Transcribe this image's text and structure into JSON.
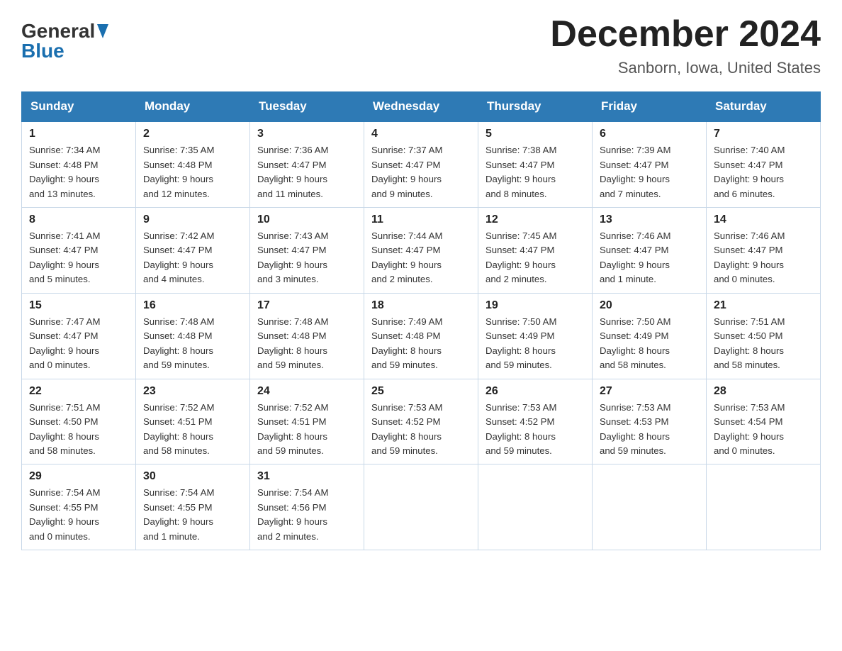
{
  "header": {
    "logo_general": "General",
    "logo_blue": "Blue",
    "month_title": "December 2024",
    "location": "Sanborn, Iowa, United States"
  },
  "days_of_week": [
    "Sunday",
    "Monday",
    "Tuesday",
    "Wednesday",
    "Thursday",
    "Friday",
    "Saturday"
  ],
  "weeks": [
    [
      {
        "day": "1",
        "sunrise": "7:34 AM",
        "sunset": "4:48 PM",
        "daylight": "9 hours and 13 minutes."
      },
      {
        "day": "2",
        "sunrise": "7:35 AM",
        "sunset": "4:48 PM",
        "daylight": "9 hours and 12 minutes."
      },
      {
        "day": "3",
        "sunrise": "7:36 AM",
        "sunset": "4:47 PM",
        "daylight": "9 hours and 11 minutes."
      },
      {
        "day": "4",
        "sunrise": "7:37 AM",
        "sunset": "4:47 PM",
        "daylight": "9 hours and 9 minutes."
      },
      {
        "day": "5",
        "sunrise": "7:38 AM",
        "sunset": "4:47 PM",
        "daylight": "9 hours and 8 minutes."
      },
      {
        "day": "6",
        "sunrise": "7:39 AM",
        "sunset": "4:47 PM",
        "daylight": "9 hours and 7 minutes."
      },
      {
        "day": "7",
        "sunrise": "7:40 AM",
        "sunset": "4:47 PM",
        "daylight": "9 hours and 6 minutes."
      }
    ],
    [
      {
        "day": "8",
        "sunrise": "7:41 AM",
        "sunset": "4:47 PM",
        "daylight": "9 hours and 5 minutes."
      },
      {
        "day": "9",
        "sunrise": "7:42 AM",
        "sunset": "4:47 PM",
        "daylight": "9 hours and 4 minutes."
      },
      {
        "day": "10",
        "sunrise": "7:43 AM",
        "sunset": "4:47 PM",
        "daylight": "9 hours and 3 minutes."
      },
      {
        "day": "11",
        "sunrise": "7:44 AM",
        "sunset": "4:47 PM",
        "daylight": "9 hours and 2 minutes."
      },
      {
        "day": "12",
        "sunrise": "7:45 AM",
        "sunset": "4:47 PM",
        "daylight": "9 hours and 2 minutes."
      },
      {
        "day": "13",
        "sunrise": "7:46 AM",
        "sunset": "4:47 PM",
        "daylight": "9 hours and 1 minute."
      },
      {
        "day": "14",
        "sunrise": "7:46 AM",
        "sunset": "4:47 PM",
        "daylight": "9 hours and 0 minutes."
      }
    ],
    [
      {
        "day": "15",
        "sunrise": "7:47 AM",
        "sunset": "4:47 PM",
        "daylight": "9 hours and 0 minutes."
      },
      {
        "day": "16",
        "sunrise": "7:48 AM",
        "sunset": "4:48 PM",
        "daylight": "8 hours and 59 minutes."
      },
      {
        "day": "17",
        "sunrise": "7:48 AM",
        "sunset": "4:48 PM",
        "daylight": "8 hours and 59 minutes."
      },
      {
        "day": "18",
        "sunrise": "7:49 AM",
        "sunset": "4:48 PM",
        "daylight": "8 hours and 59 minutes."
      },
      {
        "day": "19",
        "sunrise": "7:50 AM",
        "sunset": "4:49 PM",
        "daylight": "8 hours and 59 minutes."
      },
      {
        "day": "20",
        "sunrise": "7:50 AM",
        "sunset": "4:49 PM",
        "daylight": "8 hours and 58 minutes."
      },
      {
        "day": "21",
        "sunrise": "7:51 AM",
        "sunset": "4:50 PM",
        "daylight": "8 hours and 58 minutes."
      }
    ],
    [
      {
        "day": "22",
        "sunrise": "7:51 AM",
        "sunset": "4:50 PM",
        "daylight": "8 hours and 58 minutes."
      },
      {
        "day": "23",
        "sunrise": "7:52 AM",
        "sunset": "4:51 PM",
        "daylight": "8 hours and 58 minutes."
      },
      {
        "day": "24",
        "sunrise": "7:52 AM",
        "sunset": "4:51 PM",
        "daylight": "8 hours and 59 minutes."
      },
      {
        "day": "25",
        "sunrise": "7:53 AM",
        "sunset": "4:52 PM",
        "daylight": "8 hours and 59 minutes."
      },
      {
        "day": "26",
        "sunrise": "7:53 AM",
        "sunset": "4:52 PM",
        "daylight": "8 hours and 59 minutes."
      },
      {
        "day": "27",
        "sunrise": "7:53 AM",
        "sunset": "4:53 PM",
        "daylight": "8 hours and 59 minutes."
      },
      {
        "day": "28",
        "sunrise": "7:53 AM",
        "sunset": "4:54 PM",
        "daylight": "9 hours and 0 minutes."
      }
    ],
    [
      {
        "day": "29",
        "sunrise": "7:54 AM",
        "sunset": "4:55 PM",
        "daylight": "9 hours and 0 minutes."
      },
      {
        "day": "30",
        "sunrise": "7:54 AM",
        "sunset": "4:55 PM",
        "daylight": "9 hours and 1 minute."
      },
      {
        "day": "31",
        "sunrise": "7:54 AM",
        "sunset": "4:56 PM",
        "daylight": "9 hours and 2 minutes."
      },
      null,
      null,
      null,
      null
    ]
  ],
  "labels": {
    "sunrise": "Sunrise:",
    "sunset": "Sunset:",
    "daylight": "Daylight:"
  }
}
